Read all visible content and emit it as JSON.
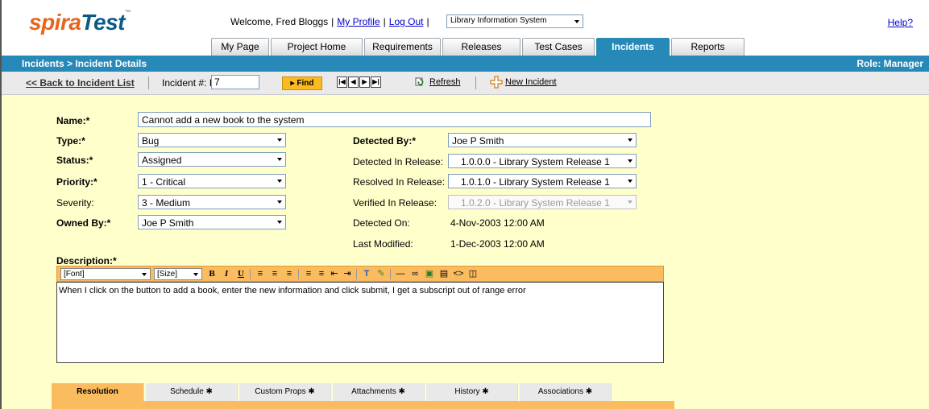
{
  "app": {
    "logo_spira": "spira",
    "logo_test": "Test",
    "logo_tm": "™"
  },
  "header": {
    "welcome": "Welcome, Fred Bloggs",
    "my_profile": "My Profile",
    "log_out": "Log Out",
    "project": "Library Information System",
    "help": "Help?"
  },
  "tabs": [
    "My Page",
    "Project Home",
    "Requirements",
    "Releases",
    "Test Cases",
    "Incidents",
    "Reports"
  ],
  "breadcrumb": "Incidents > Incident Details",
  "role": "Role: Manager",
  "toolbar": {
    "back": "<< Back to Incident List",
    "incident_label": "Incident #: IN",
    "incident_value": "7",
    "find": "▸ Find",
    "refresh": "Refresh",
    "new_incident": "New Incident"
  },
  "form": {
    "name_label": "Name:*",
    "name_value": "Cannot add a new book to the system",
    "type_label": "Type:*",
    "type_value": "Bug",
    "status_label": "Status:*",
    "status_value": "Assigned",
    "priority_label": "Priority:*",
    "priority_value": "1 - Critical",
    "severity_label": "Severity:",
    "severity_value": "3 - Medium",
    "owner_label": "Owned By:*",
    "owner_value": "Joe P Smith",
    "detected_by_label": "Detected By:*",
    "detected_by_value": "Joe P Smith",
    "detected_release_label": "Detected In Release:",
    "detected_release_value": "1.0.0.0 - Library System Release 1",
    "resolved_release_label": "Resolved In Release:",
    "resolved_release_value": "1.0.1.0 - Library System Release 1",
    "verified_release_label": "Verified In Release:",
    "verified_release_value": "1.0.2.0 - Library System Release 1",
    "detected_on_label": "Detected On:",
    "detected_on_value": "4-Nov-2003 12:00 AM",
    "last_modified_label": "Last Modified:",
    "last_modified_value": "1-Dec-2003 12:00 AM",
    "description_label": "Description:*",
    "description_text": "When I click on the button to add a book, enter the new information and click submit, I get a subscript out of range error"
  },
  "editor": {
    "font": "[Font]",
    "size": "[Size]"
  },
  "bottom_tabs": [
    "Resolution",
    "Schedule ✱",
    "Custom Props ✱",
    "Attachments ✱",
    "History ✱",
    "Associations ✱"
  ]
}
